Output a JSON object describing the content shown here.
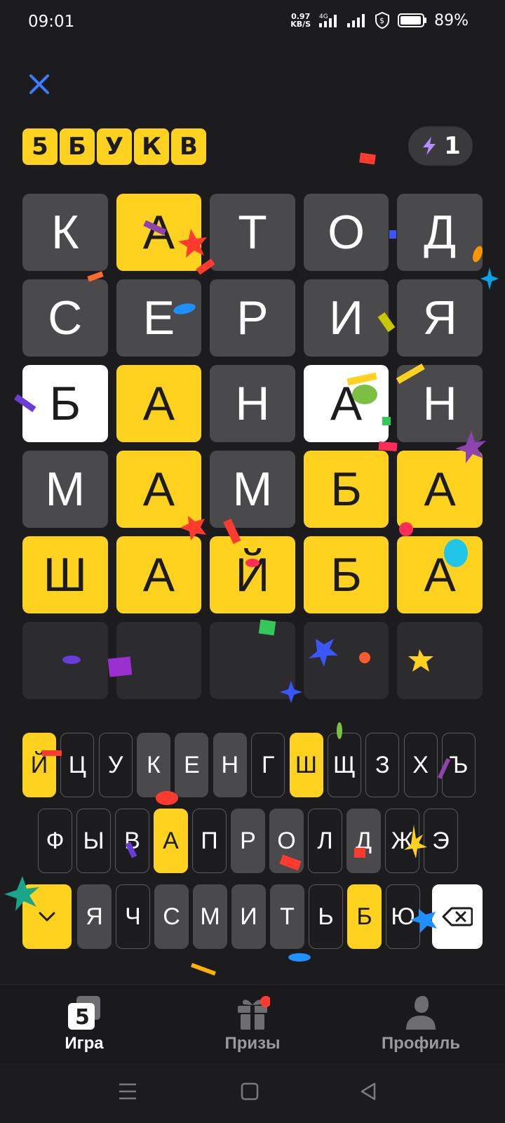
{
  "status": {
    "time": "09:01",
    "net_speed_value": "0.97",
    "net_speed_unit": "KB/S",
    "network": "4G",
    "battery": "89%"
  },
  "header": {
    "logo_letters": [
      "5",
      "Б",
      "У",
      "К",
      "В"
    ],
    "hint_count": "1"
  },
  "board": {
    "rows": [
      [
        {
          "letter": "К",
          "state": "absent"
        },
        {
          "letter": "А",
          "state": "correct"
        },
        {
          "letter": "Т",
          "state": "absent"
        },
        {
          "letter": "О",
          "state": "absent"
        },
        {
          "letter": "Д",
          "state": "absent"
        }
      ],
      [
        {
          "letter": "С",
          "state": "absent"
        },
        {
          "letter": "Е",
          "state": "absent"
        },
        {
          "letter": "Р",
          "state": "absent"
        },
        {
          "letter": "И",
          "state": "absent"
        },
        {
          "letter": "Я",
          "state": "absent"
        }
      ],
      [
        {
          "letter": "Б",
          "state": "present"
        },
        {
          "letter": "А",
          "state": "correct"
        },
        {
          "letter": "Н",
          "state": "absent"
        },
        {
          "letter": "А",
          "state": "present"
        },
        {
          "letter": "Н",
          "state": "absent"
        }
      ],
      [
        {
          "letter": "М",
          "state": "absent"
        },
        {
          "letter": "А",
          "state": "correct"
        },
        {
          "letter": "М",
          "state": "absent"
        },
        {
          "letter": "Б",
          "state": "correct"
        },
        {
          "letter": "А",
          "state": "correct"
        }
      ],
      [
        {
          "letter": "Ш",
          "state": "correct"
        },
        {
          "letter": "А",
          "state": "correct"
        },
        {
          "letter": "Й",
          "state": "correct"
        },
        {
          "letter": "Б",
          "state": "correct"
        },
        {
          "letter": "А",
          "state": "correct"
        }
      ],
      [
        {
          "letter": "",
          "state": "empty"
        },
        {
          "letter": "",
          "state": "empty"
        },
        {
          "letter": "",
          "state": "empty"
        },
        {
          "letter": "",
          "state": "empty"
        },
        {
          "letter": "",
          "state": "empty"
        }
      ]
    ]
  },
  "keyboard": {
    "row1": [
      {
        "label": "Й",
        "state": "correct"
      },
      {
        "label": "Ц",
        "state": "unused"
      },
      {
        "label": "У",
        "state": "unused"
      },
      {
        "label": "К",
        "state": "absent"
      },
      {
        "label": "Е",
        "state": "absent"
      },
      {
        "label": "Н",
        "state": "absent"
      },
      {
        "label": "Г",
        "state": "unused"
      },
      {
        "label": "Ш",
        "state": "correct"
      },
      {
        "label": "Щ",
        "state": "unused"
      },
      {
        "label": "З",
        "state": "unused"
      },
      {
        "label": "Х",
        "state": "unused"
      },
      {
        "label": "Ъ",
        "state": "unused"
      }
    ],
    "row2": [
      {
        "label": "Ф",
        "state": "unused"
      },
      {
        "label": "Ы",
        "state": "unused"
      },
      {
        "label": "В",
        "state": "unused"
      },
      {
        "label": "А",
        "state": "correct"
      },
      {
        "label": "П",
        "state": "unused"
      },
      {
        "label": "Р",
        "state": "absent"
      },
      {
        "label": "О",
        "state": "absent"
      },
      {
        "label": "Л",
        "state": "unused"
      },
      {
        "label": "Д",
        "state": "absent"
      },
      {
        "label": "Ж",
        "state": "unused"
      },
      {
        "label": "Э",
        "state": "unused"
      }
    ],
    "row3": [
      {
        "label": "Я",
        "state": "absent"
      },
      {
        "label": "Ч",
        "state": "unused"
      },
      {
        "label": "С",
        "state": "absent"
      },
      {
        "label": "М",
        "state": "absent"
      },
      {
        "label": "И",
        "state": "absent"
      },
      {
        "label": "Т",
        "state": "absent"
      },
      {
        "label": "Ь",
        "state": "unused"
      },
      {
        "label": "Б",
        "state": "correct"
      },
      {
        "label": "Ю",
        "state": "unused"
      }
    ]
  },
  "nav": {
    "items": [
      {
        "label": "Игра",
        "active": true,
        "icon": "game-icon"
      },
      {
        "label": "Призы",
        "active": false,
        "icon": "gift-icon"
      },
      {
        "label": "Профиль",
        "active": false,
        "icon": "profile-icon"
      }
    ]
  },
  "colors": {
    "background": "#1c1c1e",
    "correct": "#ffd21f",
    "present": "#ffffff",
    "absent": "#4a4a4c",
    "empty": "#2c2c2e",
    "accent_close": "#3d7dff",
    "badge": "#ff3b30"
  }
}
